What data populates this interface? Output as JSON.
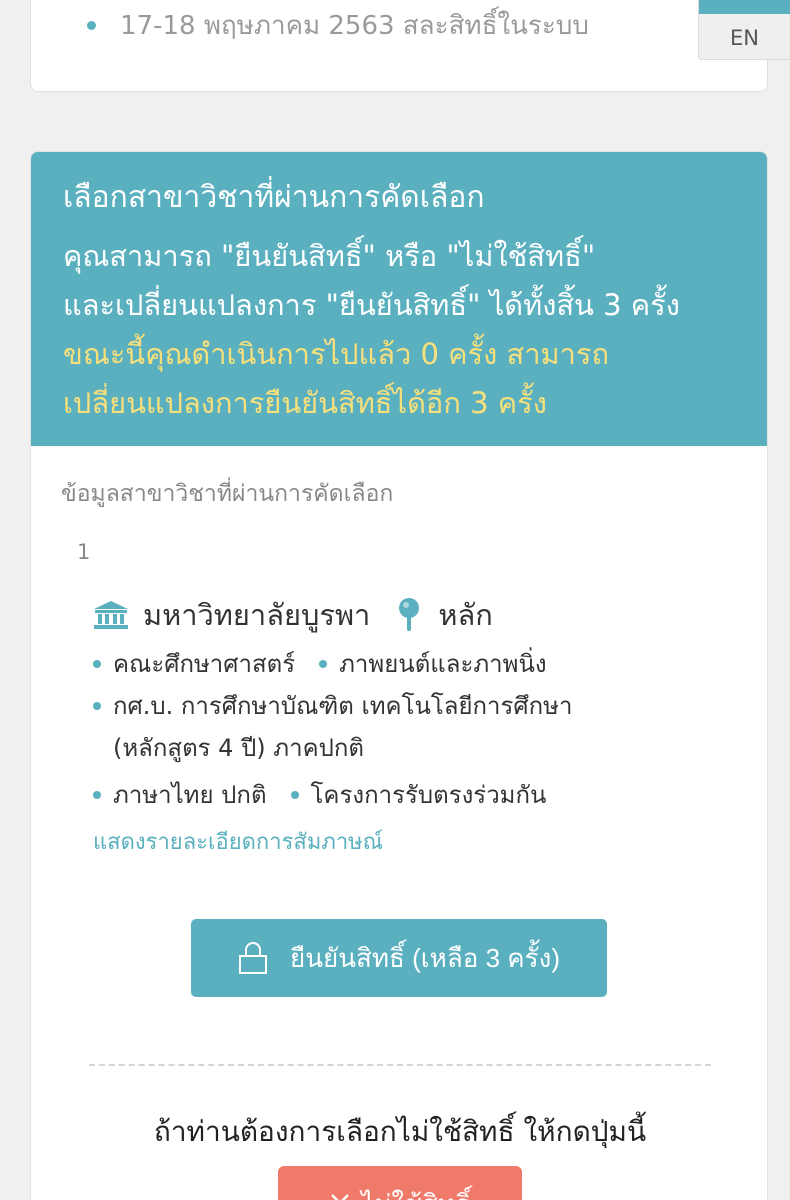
{
  "top_card": {
    "bullet_text": "17-18 พฤษภาคม 2563 สละสิทธิ์ในระบบ"
  },
  "language": {
    "en_label": "EN"
  },
  "banner": {
    "title": "เลือกสาขาวิชาที่ผ่านการคัดเลือก",
    "line1": "คุณสามารถ \"ยืนยันสิทธิ์\" หรือ \"ไม่ใช้สิทธิ์\"",
    "line2": "และเปลี่ยนแปลงการ \"ยืนยันสิทธิ์\" ได้ทั้งสิ้น 3 ครั้ง",
    "status_line1": "ขณะนี้คุณดำเนินการไปแล้ว 0 ครั้ง สามารถ",
    "status_line2": "เปลี่ยนแปลงการยืนยันสิทธิ์ได้อีก 3 ครั้ง"
  },
  "section_label": "ข้อมูลสาขาวิชาที่ผ่านการคัดเลือก",
  "item": {
    "index": "1",
    "university": "มหาวิทยาลัยบูรพา",
    "campus": "หลัก",
    "faculty": "คณะศึกษาศาสตร์",
    "major": "ภาพยนต์และภาพนิ่ง",
    "program_line1": "กศ.บ. การศึกษาบัณฑิต เทคโนโลยีการศึกษา",
    "program_line2": "(หลักสูตร 4 ปี) ภาคปกติ",
    "language": "ภาษาไทย ปกติ",
    "project": "โครงการรับตรงร่วมกัน",
    "interview_link": "แสดงรายละเอียดการสัมภาษณ์"
  },
  "confirm_button": {
    "label": "ยืนยันสิทธิ์ (เหลือ 3 ครั้ง)"
  },
  "decline": {
    "prompt": "ถ้าท่านต้องการเลือกไม่ใช้สิทธิ์ ให้กดปุ่มนี้",
    "button_label": "ไม่ใช้สิทธิ์"
  },
  "colors": {
    "accent": "#5bb0bf",
    "highlight": "#f7e07c",
    "decline": "#ef7a6a"
  }
}
